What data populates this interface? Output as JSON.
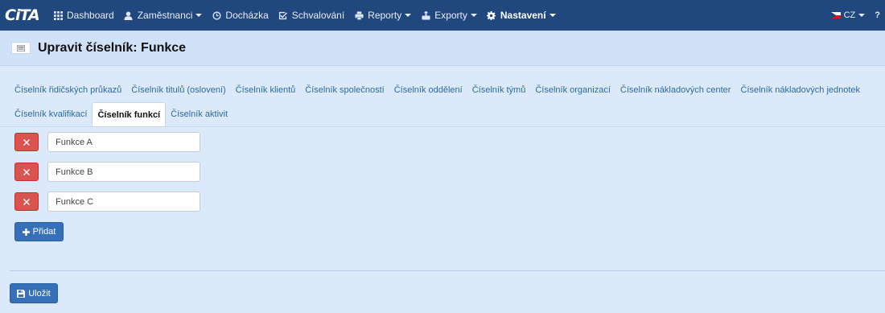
{
  "app": {
    "logo_text": "CiTA"
  },
  "nav": {
    "items": [
      {
        "label": "Dashboard",
        "icon": "grid-icon",
        "caret": false,
        "active": false
      },
      {
        "label": "Zaměstnanci",
        "icon": "user-icon",
        "caret": true,
        "active": false
      },
      {
        "label": "Docházka",
        "icon": "clock-icon",
        "caret": false,
        "active": false
      },
      {
        "label": "Schvalování",
        "icon": "check-square-icon",
        "caret": false,
        "active": false
      },
      {
        "label": "Reporty",
        "icon": "print-icon",
        "caret": true,
        "active": false
      },
      {
        "label": "Exporty",
        "icon": "export-icon",
        "caret": true,
        "active": false
      },
      {
        "label": "Nastavení",
        "icon": "gear-icon",
        "caret": true,
        "active": true
      }
    ],
    "language": "CZ",
    "help": "?"
  },
  "page": {
    "title": "Upravit číselník: Funkce"
  },
  "tabs": {
    "row1": [
      "Číselník řidičských průkazů",
      "Číselník titulů (oslovení)",
      "Číselník klientů",
      "Číselník společností",
      "Číselník oddělení",
      "Číselník týmů",
      "Číselník organizací",
      "Číselník nákladových center",
      "Číselník nákladových jednotek"
    ],
    "row2": [
      "Číselník kvalifikací",
      "Číselník funkcí",
      "Číselník aktivit"
    ],
    "active": "Číselník funkcí"
  },
  "items": [
    {
      "value": "Funkce A"
    },
    {
      "value": "Funkce B"
    },
    {
      "value": "Funkce C"
    }
  ],
  "buttons": {
    "add_label": "Přidat",
    "save_label": "Uložit"
  },
  "colors": {
    "navbar": "#21477f",
    "danger": "#d9534f",
    "primary": "#3570b8",
    "tab_link": "#2a6c9e"
  }
}
